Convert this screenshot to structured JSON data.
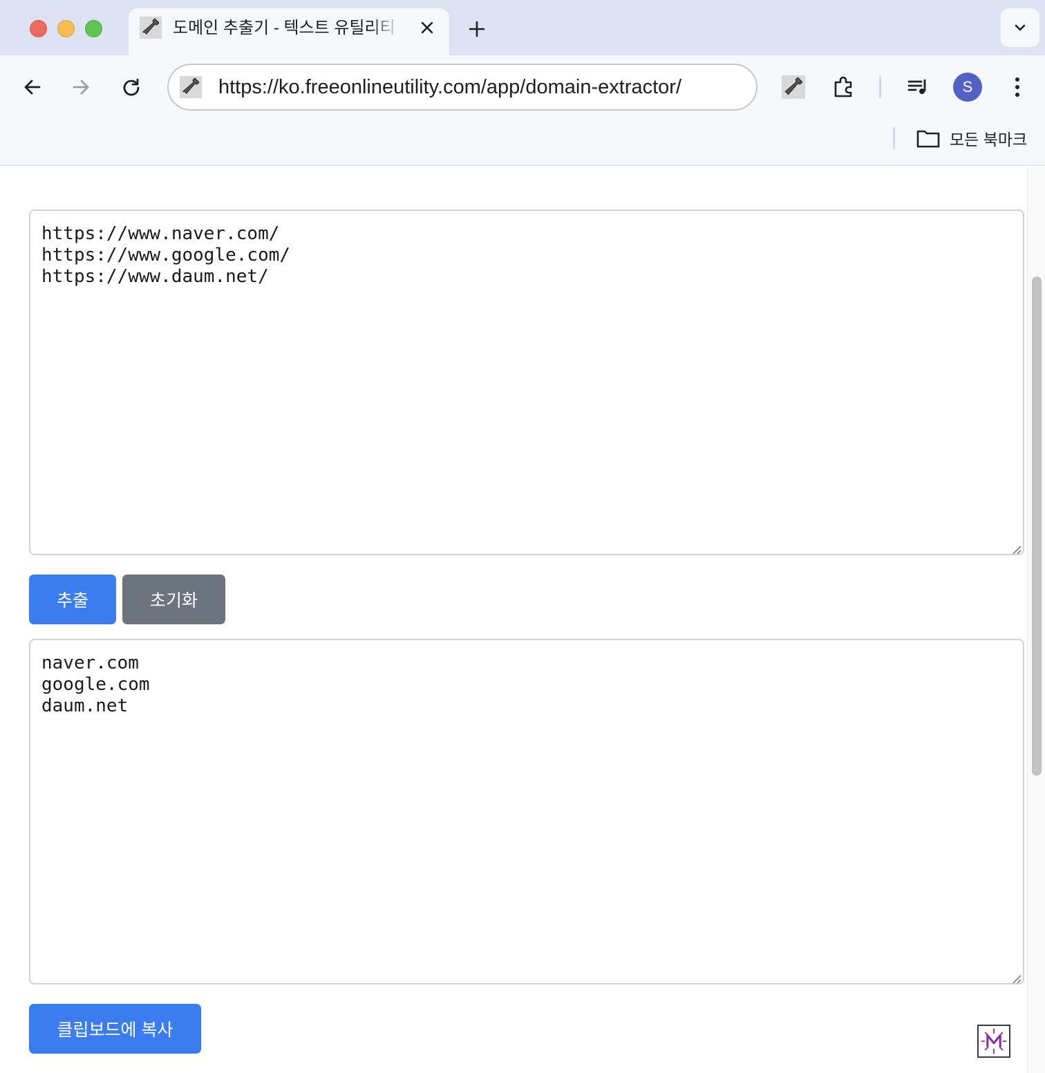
{
  "browser": {
    "tab": {
      "title": "도메인 추출기 - 텍스트 유틸리티 - 무료 온라인 유틸리티"
    },
    "address_bar": {
      "url": "https://ko.freeonlineutility.com/app/domain-extractor/"
    },
    "profile": {
      "initial": "S",
      "color": "#5360c4"
    },
    "bookmarks_bar": {
      "all_bookmarks_label": "모든 북마크"
    },
    "icons": {
      "tab_favicon": "wrench-favicon-icon",
      "tab_close": "close-icon",
      "new_tab": "plus-icon",
      "tab_search": "chevron-down-icon",
      "back": "arrow-left-icon",
      "forward": "arrow-right-icon",
      "reload": "reload-icon",
      "extension": "wrench-extension-icon",
      "extensions_menu": "puzzle-icon",
      "media": "media-queue-icon",
      "menu": "kebab-menu-icon",
      "bookmarks_folder": "folder-icon"
    }
  },
  "page": {
    "input": {
      "value": "https://www.naver.com/\nhttps://www.google.com/\nhttps://www.daum.net/"
    },
    "buttons": {
      "extract_label": "추출",
      "reset_label": "초기화",
      "copy_label": "클립보드에 복사"
    },
    "output": {
      "value": "naver.com\ngoogle.com\ndaum.net"
    },
    "colors": {
      "primary": "#3b7df0",
      "secondary": "#6c757d"
    }
  }
}
